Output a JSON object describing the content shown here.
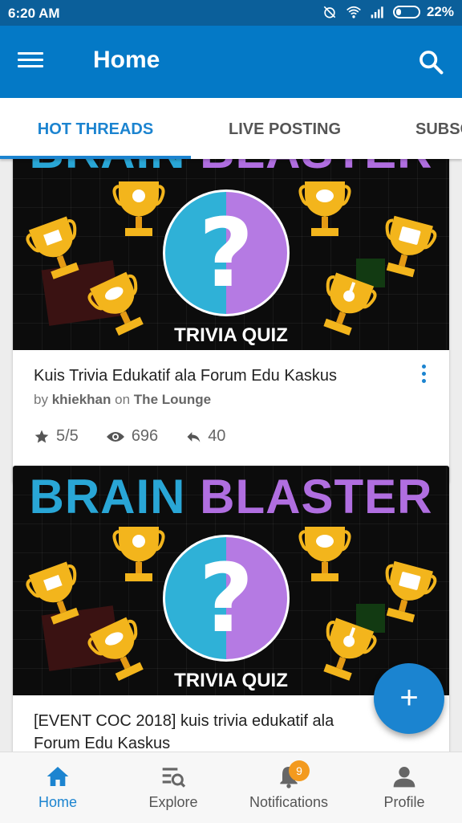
{
  "status_bar": {
    "time": "6:20 AM",
    "battery": "22%"
  },
  "app_bar": {
    "title": "Home",
    "menu_icon": "hamburger-menu-icon",
    "search_icon": "search-icon"
  },
  "tabs": [
    {
      "label": "HOT THREADS",
      "active": true
    },
    {
      "label": "LIVE POSTING",
      "active": false
    },
    {
      "label": "SUBSC",
      "active": false
    }
  ],
  "banner": {
    "word1": "BRAIN",
    "word2": "BLASTER",
    "caption": "TRIVIA QUIZ",
    "question_mark": "?"
  },
  "threads": [
    {
      "title": "Kuis Trivia Edukatif ala Forum Edu Kaskus",
      "by_label": "by",
      "author": "khiekhan",
      "on_label": "on",
      "forum": "The Lounge",
      "rating": "5/5",
      "views": "696",
      "replies": "40"
    },
    {
      "title": "[EVENT COC 2018] kuis trivia edukatif ala Forum Edu Kaskus"
    }
  ],
  "fab": {
    "label": "+"
  },
  "bottom_nav": [
    {
      "label": "Home",
      "icon": "home-icon",
      "active": true
    },
    {
      "label": "Explore",
      "icon": "explore-icon",
      "active": false
    },
    {
      "label": "Notifications",
      "icon": "bell-icon",
      "active": false,
      "badge": "9"
    },
    {
      "label": "Profile",
      "icon": "person-icon",
      "active": false
    }
  ],
  "colors": {
    "primary": "#0479c6",
    "status_bar": "#0b5f9a",
    "accent": "#1c84d0",
    "badge": "#f39a1e"
  }
}
